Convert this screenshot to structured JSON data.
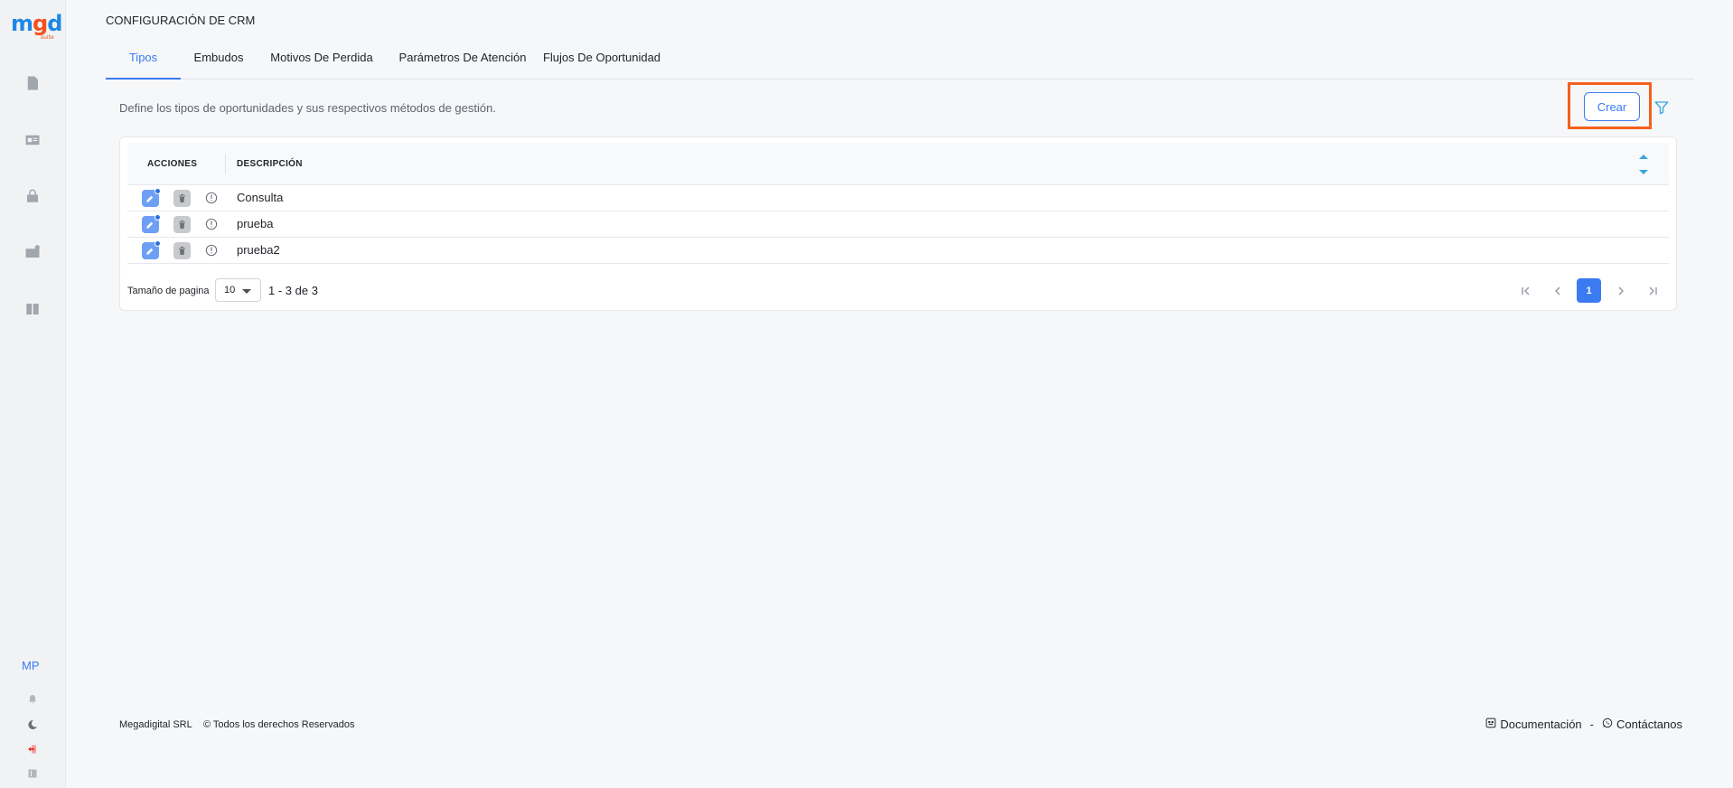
{
  "brand": {
    "logo_m": "m",
    "logo_g": "g",
    "logo_d": "d",
    "logo_suite": "suite"
  },
  "sidebar": {
    "user_initials": "MP",
    "items": [
      {
        "icon": "document-icon"
      },
      {
        "icon": "contact-card-icon"
      },
      {
        "icon": "lock-icon"
      },
      {
        "icon": "wallet-icon"
      },
      {
        "icon": "book-icon"
      }
    ]
  },
  "header": {
    "title": "CONFIGURACIÓN DE CRM",
    "tabs": [
      {
        "label": "Tipos",
        "active": true
      },
      {
        "label": "Embudos"
      },
      {
        "label": "Motivos De Perdida"
      },
      {
        "label": "Parámetros De Atención"
      },
      {
        "label": "Flujos De Oportunidad"
      }
    ]
  },
  "main": {
    "description": "Define los tipos de oportunidades y sus respectivos métodos de gestión.",
    "create_label": "Crear",
    "table": {
      "columns": [
        "ACCIONES",
        "DESCRIPCIÓN"
      ],
      "rows": [
        {
          "descripcion": "Consulta"
        },
        {
          "descripcion": "prueba"
        },
        {
          "descripcion": "prueba2"
        }
      ]
    },
    "pagination": {
      "page_size_label": "Tamaño de pagina",
      "page_size": "10",
      "range": "1 - 3 de 3",
      "current_page": "1"
    }
  },
  "footer": {
    "company": "Megadigital SRL",
    "rights": "© Todos los derechos Reservados",
    "docs": "Documentación",
    "separator": "-",
    "contact": "Contáctanos"
  },
  "colors": {
    "accent": "#3b7bf2",
    "highlight": "#f4601e"
  }
}
